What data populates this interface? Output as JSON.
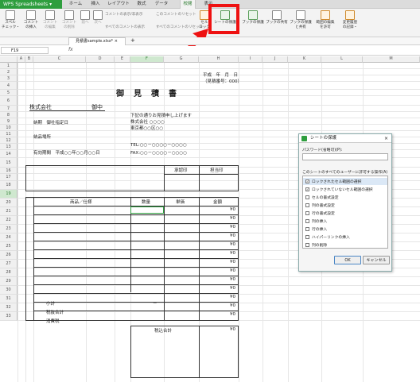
{
  "app": {
    "name": "WPS Spreadsheets"
  },
  "menu": [
    "ホーム",
    "挿入",
    "レイアウト",
    "数式",
    "データ",
    "校閲",
    "表示"
  ],
  "ribbon": {
    "spell": "スペル\nチェック・",
    "comment_insert": "コメント\nの挿入",
    "comment_prev": "コメント\nの編集",
    "comment_del": "コメント\nの削除",
    "prev": "前へ",
    "next": "次へ",
    "show_comment": "コメントの表示/非表示",
    "reset_comment": "このコメントのリセット",
    "all_comments": "すべてのコメントの表示",
    "all_reset": "すべてのコメントのリセット",
    "protect_cell": "セル\nロック",
    "protect_sheet": "シートの保護",
    "protect_book": "ブックの保護",
    "share_book": "ブックの共有",
    "protect_share": "ブックの保護\nと共有",
    "allow_edit": "範囲の編集\nを許可",
    "track": "変更履歴\nの記録・"
  },
  "file_tab": "見積書sample.xlsx*",
  "name_box": "F19",
  "fx": "fx",
  "columns": [
    "A",
    "B",
    "C",
    "D",
    "E",
    "F",
    "G",
    "H",
    "I",
    "J",
    "K",
    "L",
    "M"
  ],
  "rows": [
    "1",
    "2",
    "3",
    "4",
    "5",
    "6",
    "7",
    "8",
    "9",
    "10",
    "11",
    "12",
    "13",
    "14",
    "15",
    "16",
    "17",
    "18",
    "19",
    "20",
    "21",
    "22",
    "23",
    "24",
    "25",
    "26",
    "27",
    "28",
    "29",
    "30",
    "31",
    "32",
    "33"
  ],
  "sheet": {
    "date": "平成　年　月　日",
    "quote_no": "（見積番号：000）",
    "title": "御　見　積　書",
    "company": "株式会社",
    "honorific": "御中",
    "intro": "下記の通りお見積申し上げます",
    "our_company": "株式会社 ○○○○",
    "address": "東京都○○区○○",
    "tel": "TEL:○○－○○○○－○○○○",
    "fax": "FAX:○○－○○○○－○○○○",
    "delivery": "納期　御社指定日",
    "place": "納品場所",
    "validity": "有効期間　平成○○年○○月○○日",
    "approval": "承認印",
    "person": "担当印",
    "h_item": "商品／仕様",
    "h_qty": "数量",
    "h_price": "単価",
    "h_amount": "金額",
    "amount": "¥0",
    "subtotal": "小計",
    "dash": "－",
    "tax_excl": "税抜合計",
    "tax": "消費税",
    "total": "税込合計"
  },
  "dialog": {
    "title": "シートの保護",
    "pw_label": "パスワード(省略可)(P):",
    "allow_label": "このシートのすべてのユーザーに許可する操作(A)",
    "options": [
      {
        "label": "ロックされたセル範囲の選択",
        "checked": true
      },
      {
        "label": "ロックされていないセル範囲の選択",
        "checked": true
      },
      {
        "label": "セルの書式設定",
        "checked": false
      },
      {
        "label": "列の書式設定",
        "checked": false
      },
      {
        "label": "行の書式設定",
        "checked": false
      },
      {
        "label": "列の挿入",
        "checked": false
      },
      {
        "label": "行の挿入",
        "checked": false
      },
      {
        "label": "ハイパーリンクの挿入",
        "checked": false
      },
      {
        "label": "列の削除",
        "checked": false
      }
    ],
    "ok": "OK",
    "cancel": "キャンセル"
  }
}
